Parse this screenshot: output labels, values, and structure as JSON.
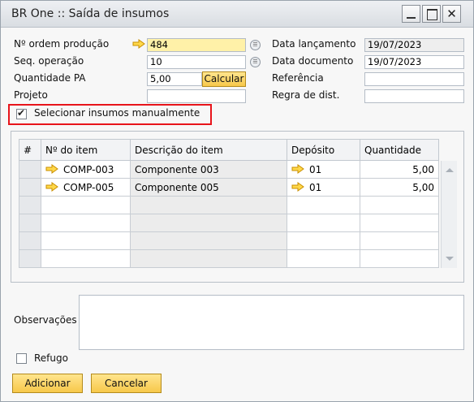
{
  "window": {
    "title": "BR One :: Saída de insumos",
    "minimize_icon": "minimize-icon",
    "maximize_icon": "maximize-icon",
    "close_glyph": "✕"
  },
  "header": {
    "ordem_label": "Nº ordem produção",
    "ordem_value": "484",
    "seq_label": "Seq. operação",
    "seq_value": "10",
    "qtd_label": "Quantidade PA",
    "qtd_value": "5,00",
    "calcular_label": "Calcular",
    "projeto_label": "Projeto",
    "projeto_value": "",
    "data_lanc_label": "Data lançamento",
    "data_lanc_value": "19/07/2023",
    "data_doc_label": "Data documento",
    "data_doc_value": "19/07/2023",
    "referencia_label": "Referência",
    "referencia_value": "",
    "regra_label": "Regra de dist.",
    "regra_value": ""
  },
  "manual_select": {
    "label": "Selecionar insumos manualmente",
    "checked": true,
    "check_glyph": "✔"
  },
  "grid": {
    "columns": [
      "#",
      "Nº do item",
      "Descrição do item",
      "Depósito",
      "Quantidade"
    ],
    "rows": [
      {
        "num": "",
        "item": "COMP-003",
        "desc": "Componente 003",
        "deposito": "01",
        "qtd": "5,00"
      },
      {
        "num": "",
        "item": "COMP-005",
        "desc": "Componente 005",
        "deposito": "01",
        "qtd": "5,00"
      },
      {
        "num": "",
        "item": "",
        "desc": "",
        "deposito": "",
        "qtd": ""
      },
      {
        "num": "",
        "item": "",
        "desc": "",
        "deposito": "",
        "qtd": ""
      },
      {
        "num": "",
        "item": "",
        "desc": "",
        "deposito": "",
        "qtd": ""
      },
      {
        "num": "",
        "item": "",
        "desc": "",
        "deposito": "",
        "qtd": ""
      }
    ]
  },
  "observacoes": {
    "label": "Observações",
    "value": ""
  },
  "refugo": {
    "label": "Refugo",
    "checked": false
  },
  "buttons": {
    "adicionar": "Adicionar",
    "cancelar": "Cancelar"
  },
  "colors": {
    "accent_yellow": "#f7c84a",
    "highlight_red": "#e8141b",
    "link_arrow": "#f0b400"
  }
}
